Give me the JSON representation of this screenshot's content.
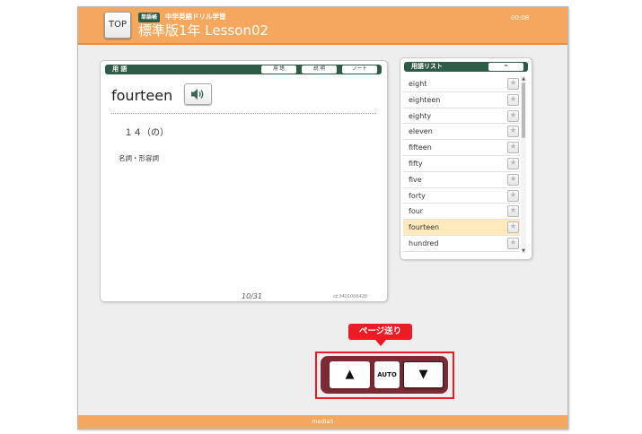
{
  "header": {
    "top_label": "TOP",
    "badge": "単語帳",
    "subtitle": "中学英語ドリル学習",
    "title": "標準版1年 Lesson02",
    "timer": "00:08"
  },
  "term_panel": {
    "header_label": "用 語",
    "buttons": [
      "用 語",
      "説 明",
      "ノート"
    ],
    "word": "fourteen",
    "meaning": "１４（の）",
    "part_of_speech": "名詞・形容詞",
    "page_count": "10/31",
    "word_id": "id:3401006420"
  },
  "word_list": {
    "header_label": "用語リスト",
    "sort_label": "=",
    "items": [
      {
        "label": "eight",
        "active": false
      },
      {
        "label": "eighteen",
        "active": false
      },
      {
        "label": "eighty",
        "active": false
      },
      {
        "label": "eleven",
        "active": false
      },
      {
        "label": "fifteen",
        "active": false
      },
      {
        "label": "fifty",
        "active": false
      },
      {
        "label": "five",
        "active": false
      },
      {
        "label": "forty",
        "active": false
      },
      {
        "label": "four",
        "active": false
      },
      {
        "label": "fourteen",
        "active": true
      },
      {
        "label": "hundred",
        "active": false
      }
    ],
    "star_glyph": "★",
    "scroll_up": "▲",
    "scroll_down": "▼"
  },
  "controls": {
    "callout": "ページ送り",
    "prev": "▲",
    "auto": "AUTO",
    "next": "▼"
  },
  "footer": {
    "brand": "media5"
  },
  "colors": {
    "header_orange": "#f6a75e",
    "panel_header_green": "#2d5b46",
    "active_row": "#ffe9bd",
    "callout_red": "#ee1b24",
    "controls_bar": "#7d2a34"
  },
  "icons": {
    "speaker": "speaker-icon",
    "star": "star-icon"
  }
}
